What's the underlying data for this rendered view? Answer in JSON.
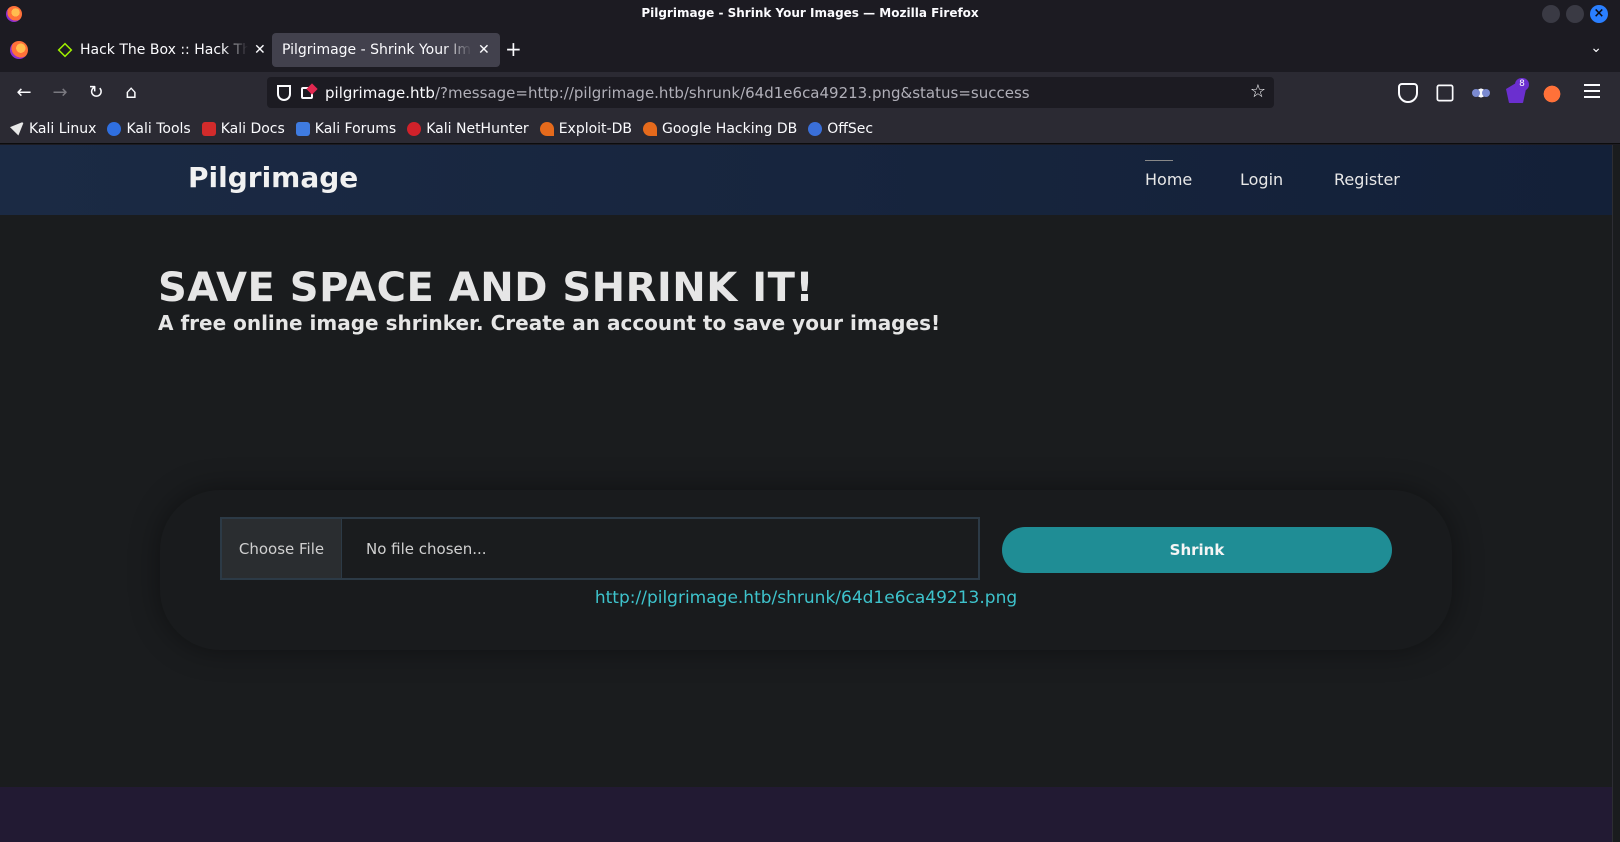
{
  "window": {
    "title": "Pilgrimage - Shrink Your Images — Mozilla Firefox"
  },
  "tabs": [
    {
      "label": "Hack The Box :: Hack The Box",
      "active": false
    },
    {
      "label": "Pilgrimage - Shrink Your Images",
      "active": true
    }
  ],
  "urlbar": {
    "host": "pilgrimage.htb",
    "path": "/?message=http://pilgrimage.htb/shrunk/64d1e6ca49213.png&status=success"
  },
  "toolbar": {
    "extension_badge": "8"
  },
  "bookmarks": [
    {
      "label": "Kali Linux",
      "color": "#e8e8e8"
    },
    {
      "label": "Kali Tools",
      "color": "#2f6fe0"
    },
    {
      "label": "Kali Docs",
      "color": "#d22b2b"
    },
    {
      "label": "Kali Forums",
      "color": "#3f7be0"
    },
    {
      "label": "Kali NetHunter",
      "color": "#d0212a"
    },
    {
      "label": "Exploit-DB",
      "color": "#e56a1c"
    },
    {
      "label": "Google Hacking DB",
      "color": "#e56a1c"
    },
    {
      "label": "OffSec",
      "color": "#3a6fd8"
    }
  ],
  "site": {
    "brand": "Pilgrimage",
    "nav": [
      "Home",
      "Login",
      "Register"
    ],
    "hero_title": "SAVE SPACE AND SHRINK IT!",
    "hero_subtitle": "A free online image shrinker. Create an account to save your images!",
    "file_button": "Choose File",
    "file_status": "No file chosen...",
    "submit_label": "Shrink",
    "result_url": "http://pilgrimage.htb/shrunk/64d1e6ca49213.png"
  },
  "colors": {
    "accent": "#1f8d95",
    "link": "#3ec3cc",
    "header": "#1b2a44"
  }
}
